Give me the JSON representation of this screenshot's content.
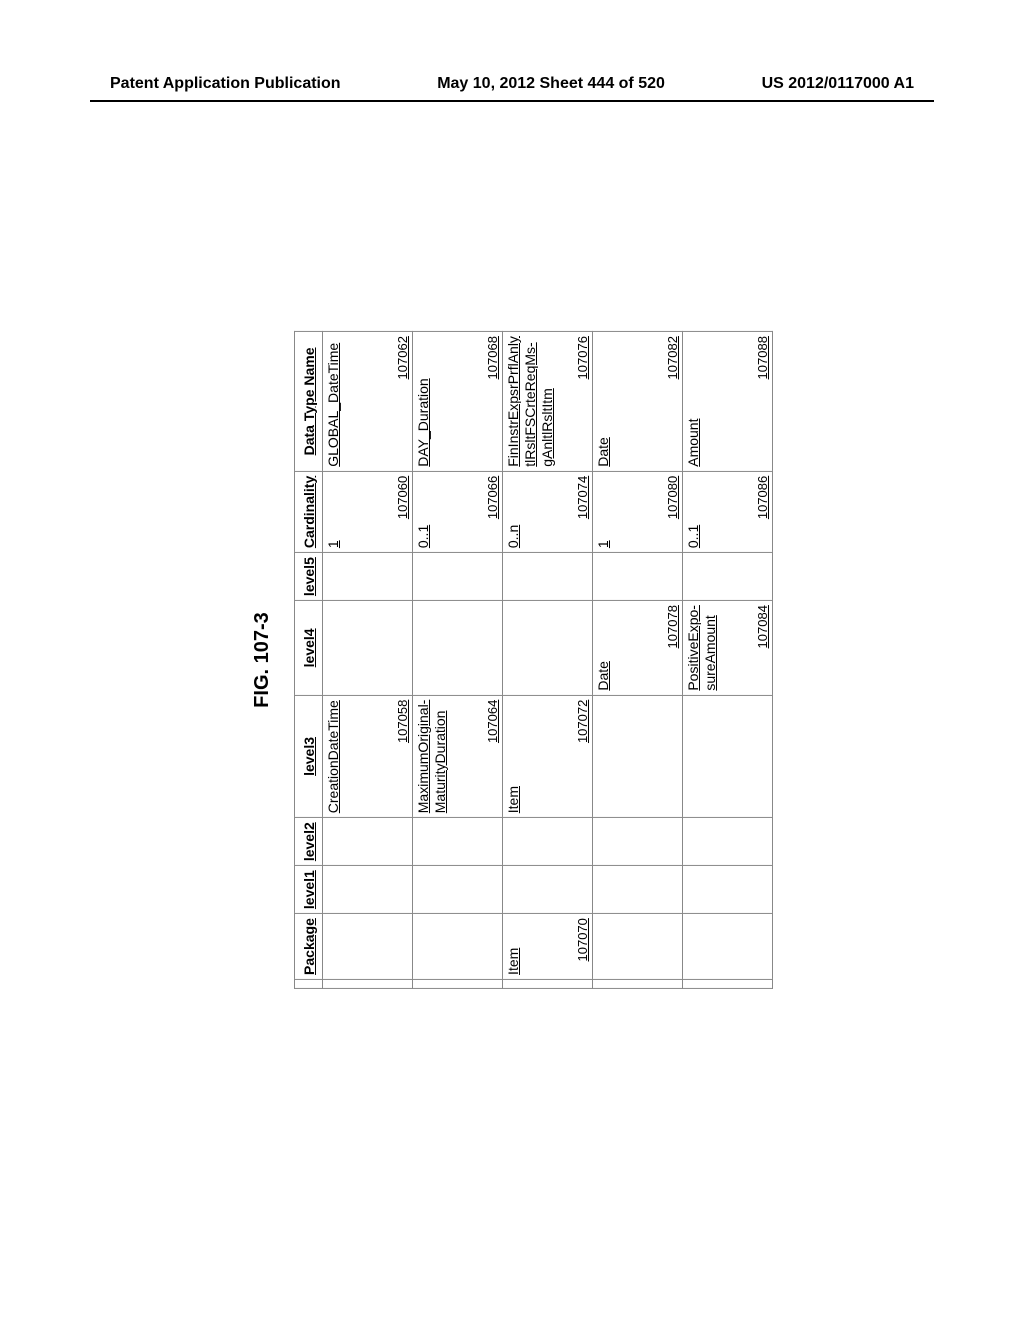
{
  "header": {
    "left": "Patent Application Publication",
    "center": "May 10, 2012  Sheet 444 of 520",
    "right": "US 2012/0117000 A1"
  },
  "figure_label": "FIG. 107-3",
  "columns": [
    "",
    "Package",
    "level1",
    "level2",
    "level3",
    "level4",
    "level5",
    "Cardinality",
    "Data Type Name"
  ],
  "rows": [
    {
      "blank": "",
      "package": "",
      "level1": "",
      "level2": "",
      "level3": "CreationDateTime",
      "level3_ref": "107058",
      "level4": "",
      "level5": "",
      "card": "1",
      "card_ref": "107060",
      "dtn": "GLOBAL_DateTime",
      "dtn_ref": "107062"
    },
    {
      "blank": "",
      "package": "",
      "level1": "",
      "level2": "",
      "level3": "MaximumOriginal-\nMaturityDuration",
      "level3_ref": "107064",
      "level4": "",
      "level5": "",
      "card": "0..1",
      "card_ref": "107066",
      "dtn": "DAY_Duration",
      "dtn_ref": "107068"
    },
    {
      "blank": "",
      "package": "Item",
      "package_ref": "107070",
      "level1": "",
      "level2": "",
      "level3": "Item",
      "level3_ref": "107072",
      "level4": "",
      "level5": "",
      "card": "0..n",
      "card_ref": "107074",
      "dtn": "FinInstrExpsrPrflAnly\ntlRsltFSCrteReqMs-\ngAnltlRsltItm",
      "dtn_ref": "107076"
    },
    {
      "blank": "",
      "package": "",
      "level1": "",
      "level2": "",
      "level3": "",
      "level4": "Date",
      "level4_ref": "107078",
      "level5": "",
      "card": "1",
      "card_ref": "107080",
      "dtn": "Date",
      "dtn_ref": "107082"
    },
    {
      "blank": "",
      "package": "",
      "level1": "",
      "level2": "",
      "level3": "",
      "level4": "PositiveExpo-\nsureAmount",
      "level4_ref": "107084",
      "level5": "",
      "card": "0..1",
      "card_ref": "107086",
      "dtn": "Amount",
      "dtn_ref": "107088"
    }
  ]
}
